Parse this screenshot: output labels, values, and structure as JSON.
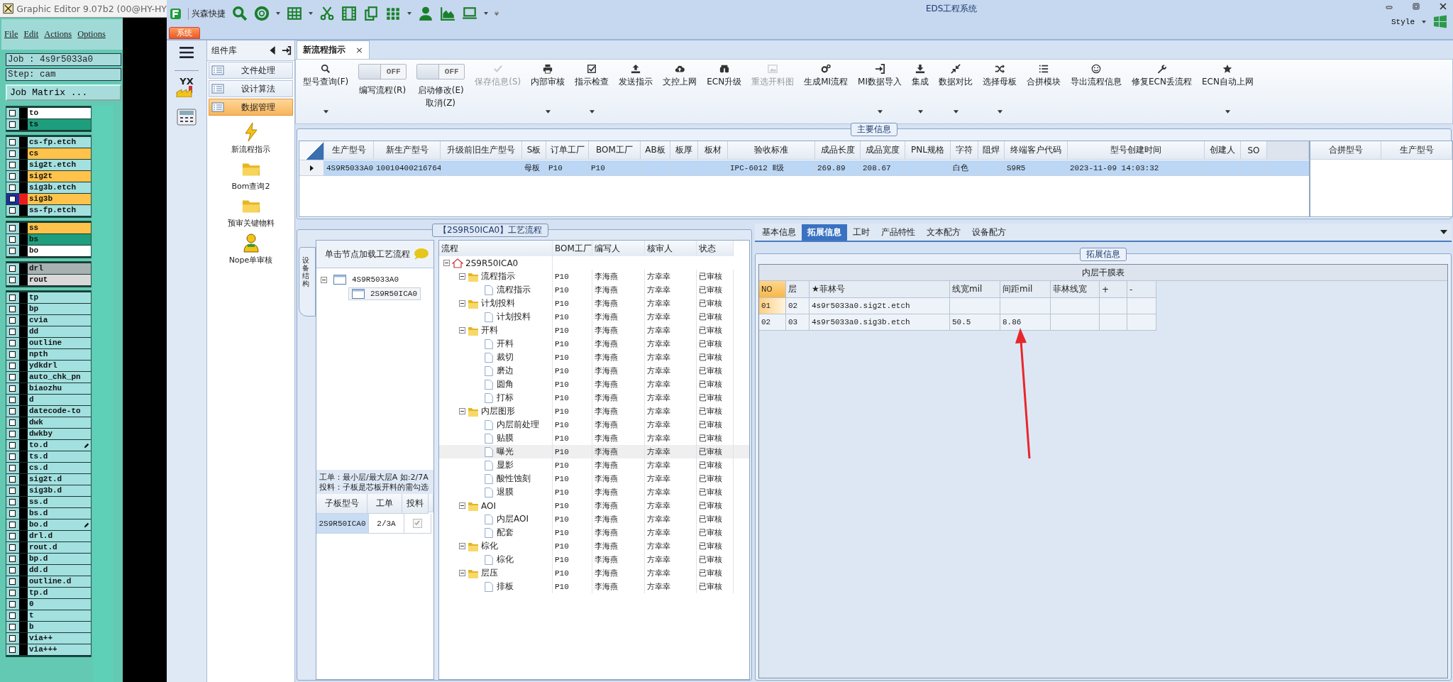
{
  "editor": {
    "title": "Graphic Editor 9.07b2 (00@HY-HY",
    "menu": [
      "File",
      "Edit",
      "Actions",
      "Options"
    ],
    "job": "Job : 4s9r5033a0",
    "step": "Step: cam",
    "matrix_button": "Job Matrix ...",
    "layer_groups": [
      [
        {
          "name": "to",
          "color": "#ffffff",
          "selected": false,
          "flagged": false
        },
        {
          "name": "ts",
          "color": "#1e9e7c",
          "selected": false,
          "flagged": false
        }
      ],
      [
        {
          "name": "cs-fp.etch",
          "color": "#a3e0e0",
          "selected": false,
          "flagged": false
        },
        {
          "name": "cs",
          "color": "#ffc24a",
          "selected": false,
          "flagged": false
        },
        {
          "name": "sig2t.etch",
          "color": "#a3e0e0",
          "selected": false,
          "flagged": false
        },
        {
          "name": "sig2t",
          "color": "#ffc24a",
          "selected": false,
          "flagged": false
        },
        {
          "name": "sig3b.etch",
          "color": "#a3e0e0",
          "selected": false,
          "flagged": false
        },
        {
          "name": "sig3b",
          "color": "#ffc24a",
          "selected": true,
          "flagged": false
        },
        {
          "name": "ss-fp.etch",
          "color": "#a3e0e0",
          "selected": false,
          "flagged": false
        }
      ],
      [
        {
          "name": "ss",
          "color": "#ffc24a",
          "selected": false,
          "flagged": false
        },
        {
          "name": "bs",
          "color": "#1e9e7c",
          "selected": false,
          "flagged": false
        },
        {
          "name": "bo",
          "color": "#ffffff",
          "selected": false,
          "flagged": false
        }
      ],
      [
        {
          "name": "drl",
          "color": "#a7b1b1",
          "selected": false,
          "flagged": false
        },
        {
          "name": "rout",
          "color": "#d8d8d8",
          "selected": false,
          "flagged": false
        }
      ],
      [
        {
          "name": "tp",
          "color": "#a3e0e0",
          "selected": false,
          "flagged": false
        },
        {
          "name": "bp",
          "color": "#a3e0e0",
          "selected": false,
          "flagged": false
        },
        {
          "name": "cvia",
          "color": "#a3e0e0",
          "selected": false,
          "flagged": false
        },
        {
          "name": "dd",
          "color": "#a3e0e0",
          "selected": false,
          "flagged": false
        },
        {
          "name": "outline",
          "color": "#a3e0e0",
          "selected": false,
          "flagged": false
        },
        {
          "name": "npth",
          "color": "#a3e0e0",
          "selected": false,
          "flagged": false
        },
        {
          "name": "ydkdrl",
          "color": "#a3e0e0",
          "selected": false,
          "flagged": false
        },
        {
          "name": "auto_chk_pn",
          "color": "#a3e0e0",
          "selected": false,
          "flagged": false
        },
        {
          "name": "biaozhu",
          "color": "#a3e0e0",
          "selected": false,
          "flagged": false
        },
        {
          "name": "d",
          "color": "#a3e0e0",
          "selected": false,
          "flagged": false
        },
        {
          "name": "datecode-to",
          "color": "#a3e0e0",
          "selected": false,
          "flagged": false
        },
        {
          "name": "dwk",
          "color": "#a3e0e0",
          "selected": false,
          "flagged": false
        },
        {
          "name": "dwkby",
          "color": "#a3e0e0",
          "selected": false,
          "flagged": false
        },
        {
          "name": "to.d",
          "color": "#a3e0e0",
          "selected": false,
          "flagged": true
        },
        {
          "name": "ts.d",
          "color": "#a3e0e0",
          "selected": false,
          "flagged": false
        },
        {
          "name": "cs.d",
          "color": "#a3e0e0",
          "selected": false,
          "flagged": false
        },
        {
          "name": "sig2t.d",
          "color": "#a3e0e0",
          "selected": false,
          "flagged": false
        },
        {
          "name": "sig3b.d",
          "color": "#a3e0e0",
          "selected": false,
          "flagged": false
        },
        {
          "name": "ss.d",
          "color": "#a3e0e0",
          "selected": false,
          "flagged": false
        },
        {
          "name": "bs.d",
          "color": "#a3e0e0",
          "selected": false,
          "flagged": false
        },
        {
          "name": "bo.d",
          "color": "#a3e0e0",
          "selected": false,
          "flagged": true
        },
        {
          "name": "drl.d",
          "color": "#a3e0e0",
          "selected": false,
          "flagged": false
        },
        {
          "name": "rout.d",
          "color": "#a3e0e0",
          "selected": false,
          "flagged": false
        },
        {
          "name": "bp.d",
          "color": "#a3e0e0",
          "selected": false,
          "flagged": false
        },
        {
          "name": "dd.d",
          "color": "#a3e0e0",
          "selected": false,
          "flagged": false
        },
        {
          "name": "outline.d",
          "color": "#a3e0e0",
          "selected": false,
          "flagged": false
        },
        {
          "name": "tp.d",
          "color": "#a3e0e0",
          "selected": false,
          "flagged": false
        },
        {
          "name": "0",
          "color": "#a3e0e0",
          "selected": false,
          "flagged": false
        },
        {
          "name": "t",
          "color": "#a3e0e0",
          "selected": false,
          "flagged": false
        },
        {
          "name": "b",
          "color": "#a3e0e0",
          "selected": false,
          "flagged": false
        },
        {
          "name": "via++",
          "color": "#a3e0e0",
          "selected": false,
          "flagged": false
        },
        {
          "name": "via+++",
          "color": "#a3e0e0",
          "selected": false,
          "flagged": false
        }
      ]
    ]
  },
  "app": {
    "title": "EDS工程系统",
    "quick_label": "兴森快捷",
    "style_label": "Style",
    "menu_tab": "系统",
    "nav_logo": "YX"
  },
  "sidebar": {
    "header": "组件库",
    "categories": [
      {
        "label": "文件处理",
        "selected": false
      },
      {
        "label": "设计算法",
        "selected": false
      },
      {
        "label": "数据管理",
        "selected": true
      }
    ],
    "tools": [
      "新流程指示",
      "Bom查询2",
      "预审关键物料",
      "Nope单审核"
    ]
  },
  "document_tab": {
    "label": "新流程指示",
    "close": "×"
  },
  "ribbon": [
    {
      "kind": "button",
      "label": "型号查询(F)",
      "dropdown": true,
      "disabled": false
    },
    {
      "kind": "toggle",
      "switch": "OFF",
      "on": false,
      "label": "编写流程(R)",
      "dropdown": false,
      "disabled": false
    },
    {
      "kind": "toggle",
      "switch": "OFF",
      "on": false,
      "label": "启动修改(E)",
      "label2": "取消(Z)",
      "dropdown": false,
      "disabled": false
    },
    {
      "kind": "button",
      "label": "保存信息(S)",
      "dropdown": false,
      "disabled": true
    },
    {
      "kind": "button",
      "label": "内部审核",
      "dropdown": true,
      "disabled": false
    },
    {
      "kind": "button",
      "label": "指示检查",
      "dropdown": true,
      "disabled": false
    },
    {
      "kind": "button",
      "label": "发送指示",
      "dropdown": false,
      "disabled": false
    },
    {
      "kind": "button",
      "label": "文控上网",
      "dropdown": false,
      "disabled": false
    },
    {
      "kind": "button",
      "label": "ECN升级",
      "dropdown": false,
      "disabled": false
    },
    {
      "kind": "button",
      "label": "重选开料图",
      "dropdown": false,
      "disabled": true
    },
    {
      "kind": "button",
      "label": "生成MI流程",
      "dropdown": false,
      "disabled": false
    },
    {
      "kind": "button",
      "label": "MI数据导入",
      "dropdown": true,
      "disabled": false
    },
    {
      "kind": "button",
      "label": "集成",
      "dropdown": true,
      "disabled": false
    },
    {
      "kind": "button",
      "label": "数据对比",
      "dropdown": true,
      "disabled": false
    },
    {
      "kind": "button",
      "label": "选择母板",
      "dropdown": true,
      "disabled": false
    },
    {
      "kind": "button",
      "label": "合拼模块",
      "dropdown": false,
      "disabled": false
    },
    {
      "kind": "button",
      "label": "导出流程信息",
      "dropdown": false,
      "disabled": false
    },
    {
      "kind": "button",
      "label": "修复ECN丢流程",
      "dropdown": false,
      "disabled": false
    },
    {
      "kind": "button",
      "label": "ECN自动上网",
      "dropdown": true,
      "disabled": false
    }
  ],
  "main_info": {
    "title": "主要信息",
    "columns": [
      "生产型号",
      "新生产型号",
      "升级前旧生产型号",
      "S板",
      "订单工厂",
      "BOM工厂",
      "AB板",
      "板厚",
      "板材",
      "验收标准",
      "成品长度",
      "成品宽度",
      "PNL规格",
      "字符",
      "阻焊",
      "终端客户代码",
      "型号创建时间",
      "创建人",
      "SO"
    ],
    "rows": [
      {
        "selected": true,
        "cells": [
          "4S9R5033A0",
          "10010400216764",
          "",
          "母板",
          "P10",
          "P10",
          "",
          "",
          "",
          "IPC-6012 Ⅱ级",
          "269.89",
          "208.67",
          "",
          "白色",
          "",
          "S9R5",
          "2023-11-09 14:03:32",
          "",
          ""
        ]
      }
    ],
    "side_columns": [
      "合拼型号",
      "生产型号"
    ]
  },
  "process": {
    "title": "【2S9R50ICA0】工艺流程",
    "side_tab": "设备结构",
    "panel_title": "单击节点加载工艺流程",
    "nodes": [
      {
        "label": "4S9R5033A0",
        "expanded": true,
        "selected": false,
        "children": [
          {
            "label": "2S9R50ICA0",
            "selected": true
          }
        ]
      }
    ],
    "note": [
      "工单：最小层/最大层A 如:2/7A",
      "投料：子板是芯板开料的需勾选"
    ],
    "sub_table": {
      "columns": [
        "子板型号",
        "工单",
        "投料"
      ],
      "rows": [
        {
          "cells": [
            "2S9R50ICA0",
            "2/3A"
          ],
          "checked": true
        }
      ]
    },
    "flow_columns": [
      "流程",
      "BOM工厂",
      "编写人",
      "核审人",
      "状态"
    ],
    "flow": [
      {
        "kind": "root",
        "label": "2S9R50ICA0",
        "expanded": true,
        "selected": false,
        "children": [
          {
            "kind": "folder",
            "label": "流程指示",
            "cells": [
              "P10",
              "李海燕",
              "方幸幸",
              "已审核"
            ],
            "expanded": true,
            "selected": false,
            "children": [
              {
                "kind": "step",
                "label": "流程指示",
                "cells": [
                  "P10",
                  "李海燕",
                  "方幸幸",
                  "已审核"
                ],
                "selected": false
              }
            ]
          },
          {
            "kind": "folder",
            "label": "计划投料",
            "cells": [
              "P10",
              "李海燕",
              "方幸幸",
              "已审核"
            ],
            "expanded": true,
            "selected": false,
            "children": [
              {
                "kind": "step",
                "label": "计划投料",
                "cells": [
                  "P10",
                  "李海燕",
                  "方幸幸",
                  "已审核"
                ],
                "selected": false
              }
            ]
          },
          {
            "kind": "folder",
            "label": "开料",
            "cells": [
              "P10",
              "李海燕",
              "方幸幸",
              "已审核"
            ],
            "expanded": true,
            "selected": false,
            "children": [
              {
                "kind": "step",
                "label": "开料",
                "cells": [
                  "P10",
                  "李海燕",
                  "方幸幸",
                  "已审核"
                ],
                "selected": false
              },
              {
                "kind": "step",
                "label": "裁切",
                "cells": [
                  "P10",
                  "李海燕",
                  "方幸幸",
                  "已审核"
                ],
                "selected": false
              },
              {
                "kind": "step",
                "label": "磨边",
                "cells": [
                  "P10",
                  "李海燕",
                  "方幸幸",
                  "已审核"
                ],
                "selected": false
              },
              {
                "kind": "step",
                "label": "圆角",
                "cells": [
                  "P10",
                  "李海燕",
                  "方幸幸",
                  "已审核"
                ],
                "selected": false
              },
              {
                "kind": "step",
                "label": "打标",
                "cells": [
                  "P10",
                  "李海燕",
                  "方幸幸",
                  "已审核"
                ],
                "selected": false
              }
            ]
          },
          {
            "kind": "folder",
            "label": "内层图形",
            "cells": [
              "P10",
              "李海燕",
              "方幸幸",
              "已审核"
            ],
            "expanded": true,
            "selected": false,
            "children": [
              {
                "kind": "step",
                "label": "内层前处理",
                "cells": [
                  "P10",
                  "李海燕",
                  "方幸幸",
                  "已审核"
                ],
                "selected": false
              },
              {
                "kind": "step",
                "label": "贴膜",
                "cells": [
                  "P10",
                  "李海燕",
                  "方幸幸",
                  "已审核"
                ],
                "selected": false
              },
              {
                "kind": "step",
                "label": "曝光",
                "cells": [
                  "P10",
                  "李海燕",
                  "方幸幸",
                  "已审核"
                ],
                "selected": true
              },
              {
                "kind": "step",
                "label": "显影",
                "cells": [
                  "P10",
                  "李海燕",
                  "方幸幸",
                  "已审核"
                ],
                "selected": false
              },
              {
                "kind": "step",
                "label": "酸性蚀刻",
                "cells": [
                  "P10",
                  "李海燕",
                  "方幸幸",
                  "已审核"
                ],
                "selected": false
              },
              {
                "kind": "step",
                "label": "退膜",
                "cells": [
                  "P10",
                  "李海燕",
                  "方幸幸",
                  "已审核"
                ],
                "selected": false
              }
            ]
          },
          {
            "kind": "folder",
            "label": "AOI",
            "cells": [
              "P10",
              "李海燕",
              "方幸幸",
              "已审核"
            ],
            "expanded": true,
            "selected": false,
            "children": [
              {
                "kind": "step",
                "label": "内层AOI",
                "cells": [
                  "P10",
                  "李海燕",
                  "方幸幸",
                  "已审核"
                ],
                "selected": false
              },
              {
                "kind": "step",
                "label": "配套",
                "cells": [
                  "P10",
                  "李海燕",
                  "方幸幸",
                  "已审核"
                ],
                "selected": false
              }
            ]
          },
          {
            "kind": "folder",
            "label": "棕化",
            "cells": [
              "P10",
              "李海燕",
              "方幸幸",
              "已审核"
            ],
            "expanded": true,
            "selected": false,
            "children": [
              {
                "kind": "step",
                "label": "棕化",
                "cells": [
                  "P10",
                  "李海燕",
                  "方幸幸",
                  "已审核"
                ],
                "selected": false
              }
            ]
          },
          {
            "kind": "folder",
            "label": "层压",
            "cells": [
              "P10",
              "李海燕",
              "方幸幸",
              "已审核"
            ],
            "expanded": true,
            "selected": false,
            "children": [
              {
                "kind": "step",
                "label": "排板",
                "cells": [
                  "P10",
                  "李海燕",
                  "方幸幸",
                  "已审核"
                ],
                "selected": false
              }
            ]
          }
        ]
      }
    ]
  },
  "extended": {
    "tabs": [
      {
        "label": "基本信息",
        "selected": false
      },
      {
        "label": "拓展信息",
        "selected": true
      },
      {
        "label": "工时",
        "selected": false
      },
      {
        "label": "产品特性",
        "selected": false
      },
      {
        "label": "文本配方",
        "selected": false
      },
      {
        "label": "设备配方",
        "selected": false
      }
    ],
    "group_title": "拓展信息",
    "table_title": "内层干膜表",
    "columns": [
      "NO",
      "层",
      "★菲林号",
      "线宽mil",
      "间距mil",
      "菲林线宽",
      "+",
      "-"
    ],
    "rows": [
      {
        "current": true,
        "cells": [
          "01",
          "02",
          "4s9r5033a0.sig2t.etch",
          "",
          "",
          "",
          "",
          ""
        ]
      },
      {
        "current": false,
        "cells": [
          "02",
          "03",
          "4s9r5033a0.sig3b.etch",
          "50.5",
          "8.86",
          "",
          "",
          ""
        ]
      }
    ]
  }
}
